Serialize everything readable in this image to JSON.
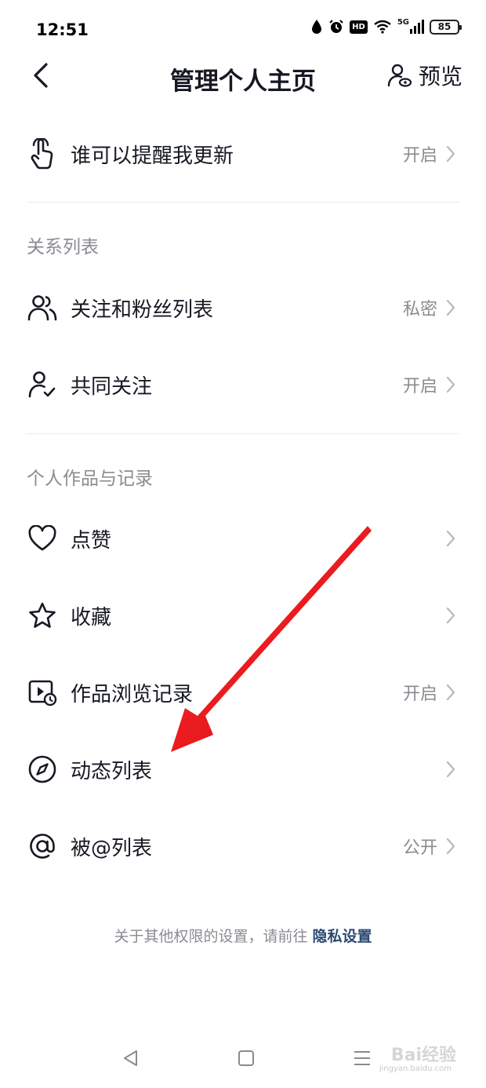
{
  "status_bar": {
    "time": "12:51",
    "network": "5G",
    "hd_label": "HD",
    "battery": "85"
  },
  "header": {
    "title": "管理个人主页",
    "preview_label": "预览"
  },
  "sections": {
    "top": {
      "items": [
        {
          "label": "谁可以提醒我更新",
          "value": "开启",
          "icon": "tap-hand-icon"
        }
      ]
    },
    "relations": {
      "title": "关系列表",
      "items": [
        {
          "label": "关注和粉丝列表",
          "value": "私密",
          "icon": "users-icon"
        },
        {
          "label": "共同关注",
          "value": "开启",
          "icon": "user-check-icon"
        }
      ]
    },
    "works": {
      "title": "个人作品与记录",
      "items": [
        {
          "label": "点赞",
          "value": "",
          "icon": "heart-icon"
        },
        {
          "label": "收藏",
          "value": "",
          "icon": "star-icon"
        },
        {
          "label": "作品浏览记录",
          "value": "开启",
          "icon": "video-history-icon"
        },
        {
          "label": "动态列表",
          "value": "",
          "icon": "compass-icon"
        },
        {
          "label": "被@列表",
          "value": "公开",
          "icon": "at-icon"
        }
      ]
    }
  },
  "footer": {
    "note_text": "关于其他权限的设置，请前往",
    "link_text": "隐私设置"
  },
  "watermark": {
    "text": "Bai经验",
    "sub": "jingyan.baidu.com"
  },
  "colors": {
    "text": "#161823",
    "secondary": "#8a8b91",
    "link": "#2c4a73",
    "arrow": "#e8141c"
  }
}
